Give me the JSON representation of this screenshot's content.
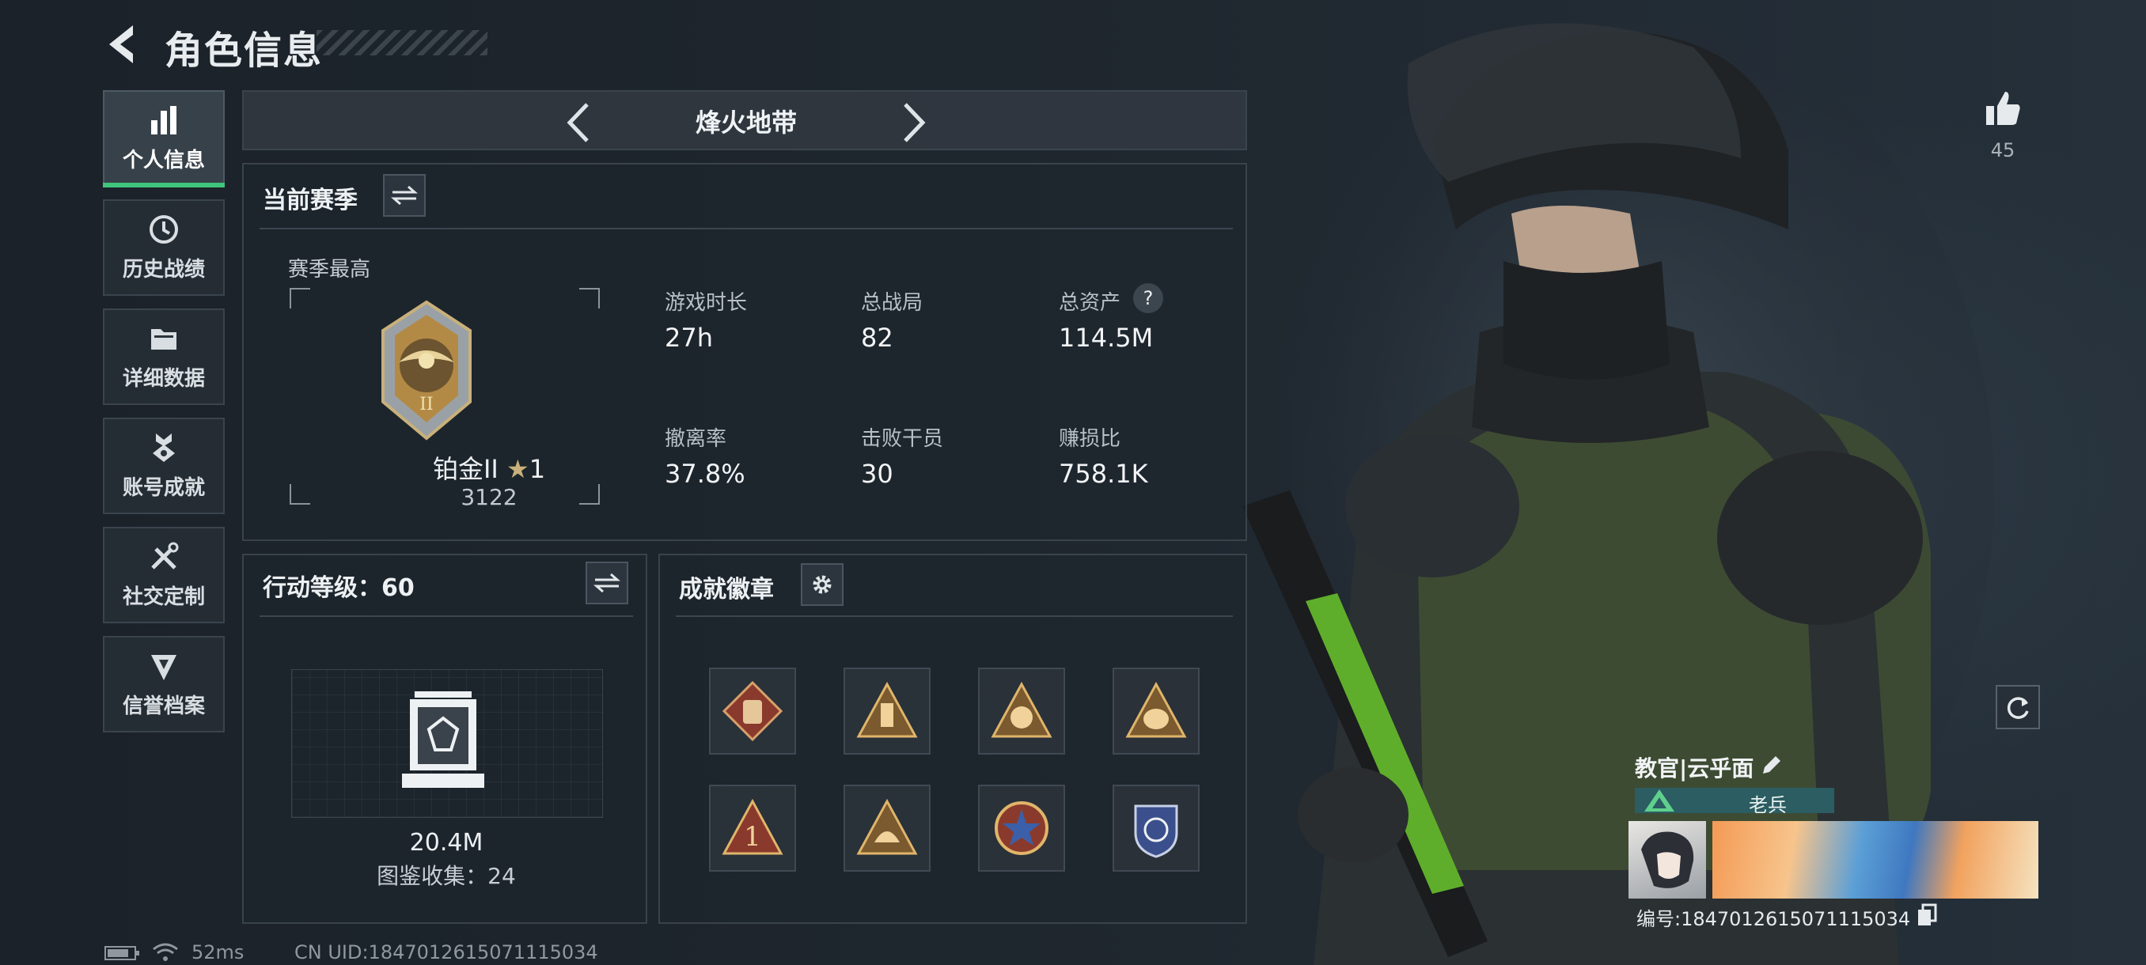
{
  "header": {
    "title": "角色信息"
  },
  "sidebar": {
    "items": [
      {
        "label": "个人信息",
        "icon": "bar-chart-icon"
      },
      {
        "label": "历史战绩",
        "icon": "history-clock-icon"
      },
      {
        "label": "详细数据",
        "icon": "folder-icon"
      },
      {
        "label": "账号成就",
        "icon": "medal-icon"
      },
      {
        "label": "社交定制",
        "icon": "tools-icon"
      },
      {
        "label": "信誉档案",
        "icon": "credit-emblem-icon"
      }
    ]
  },
  "mode": {
    "title": "烽火地带"
  },
  "season": {
    "title": "当前赛季",
    "best_label": "赛季最高",
    "rank_name": "铂金II",
    "rank_stars": "1",
    "rank_score": "3122",
    "stats": [
      {
        "label": "游戏时长",
        "value": "27h"
      },
      {
        "label": "总战局",
        "value": "82"
      },
      {
        "label": "总资产",
        "value": "114.5M"
      },
      {
        "label": "撤离率",
        "value": "37.8%"
      },
      {
        "label": "击败干员",
        "value": "30"
      },
      {
        "label": "赚损比",
        "value": "758.1K"
      }
    ],
    "help_mark": "?"
  },
  "level": {
    "title": "行动等级：60",
    "value": "20.4M",
    "collection": "图鉴收集：24"
  },
  "badges": {
    "title": "成就徽章",
    "items": [
      "bag-badge-icon",
      "tower-badge-icon",
      "money-bag-badge-icon",
      "coin-bag-badge-icon",
      "number-one-badge-icon",
      "helmet-badge-icon",
      "star-emblem-badge-icon",
      "shield-crest-badge-icon"
    ]
  },
  "profile": {
    "likes": "45",
    "name": "教官|云乎面",
    "rank_title": "老兵",
    "id_text": "编号:1847012615071115034"
  },
  "status": {
    "ping": "52ms",
    "uid": "CN UID:1847012615071115034"
  },
  "colors": {
    "accent_green": "#3fc57c",
    "rank_teal": "#2b5d62"
  }
}
